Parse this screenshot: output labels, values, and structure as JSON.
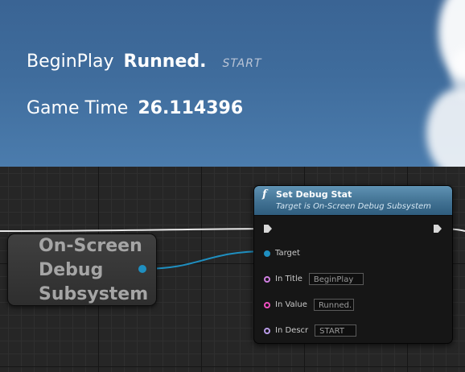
{
  "viewport": {
    "debug_rows": [
      {
        "title": "BeginPlay",
        "value": "Runned.",
        "description": "START"
      },
      {
        "title": "Game Time",
        "value": "26.114396"
      }
    ]
  },
  "graph": {
    "getter_node": {
      "label": "On-Screen Debug Subsystem"
    },
    "function_node": {
      "icon": "function-icon",
      "icon_glyph": "f",
      "title": "Set Debug Stat",
      "subtitle": "Target is On-Screen Debug Subsystem",
      "pins": {
        "target_label": "Target",
        "in_title_label": "In Title",
        "in_title_value": "BeginPlay",
        "in_value_label": "In Value",
        "in_value_value": "Runned.",
        "in_descr_label": "In Descr",
        "in_descr_value": "START"
      }
    }
  },
  "colors": {
    "exec_wire": "#e8e8e8",
    "object_wire": "#1f8fc0",
    "node_header": "#4a7fa2"
  }
}
